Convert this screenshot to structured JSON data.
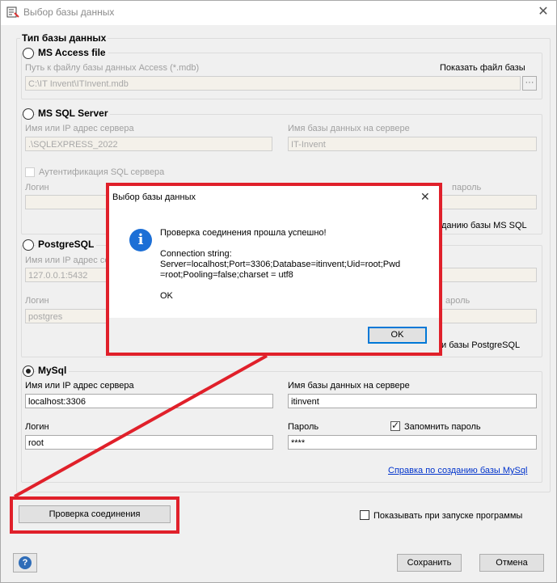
{
  "window": {
    "title": "Выбор базы данных",
    "close": "✕"
  },
  "db_type_group": {
    "title": "Тип базы данных"
  },
  "access": {
    "label": "MS Access file",
    "path_label": "Путь к файлу базы данных Access (*.mdb)",
    "show_file_label": "Показать файл базы",
    "path_value": "C:\\IT Invent\\ITInvent.mdb",
    "browse": "···"
  },
  "mssql": {
    "label": "MS SQL Server",
    "server_label": "Имя или IP адрес сервера",
    "server_value": ".\\SQLEXPRESS_2022",
    "db_label": "Имя базы данных на сервере",
    "db_value": "IT-Invent",
    "sql_auth_label": "Аутентификация SQL сервера",
    "login_label": "Логин",
    "password_label": "пароль",
    "help_link_partial": "данию базы MS SQL"
  },
  "postgres": {
    "label": "PostgreSQL",
    "server_label": "Имя или IP адрес серв",
    "server_value": "127.0.0.1:5432",
    "login_label": "Логин",
    "login_value": "postgres",
    "password_label": "ароль",
    "help_link_partial": "и базы PostgreSQL"
  },
  "mysql": {
    "label": "MySql",
    "selected": true,
    "server_label": "Имя или IP адрес сервера",
    "server_value": "localhost:3306",
    "db_label": "Имя базы данных на сервере",
    "db_value": "itinvent",
    "login_label": "Логин",
    "login_value": "root",
    "password_label": "Пароль",
    "password_value": "****",
    "remember_label": "Запомнить пароль",
    "remember_checked": true,
    "help_link": "Справка по созданию базы MySql"
  },
  "check_button": "Проверка соединения",
  "show_on_start_label": "Показывать при запуске программы",
  "help_button": "?",
  "save_button": "Сохранить",
  "cancel_button": "Отмена",
  "dialog": {
    "title": "Выбор базы данных",
    "close": "✕",
    "icon": "i",
    "message": "Проверка соединения прошла успешно!",
    "conn_label": "Connection string:",
    "conn_line1": "Server=localhost;Port=3306;Database=itinvent;Uid=root;Pwd",
    "conn_line2": "=root;Pooling=false;charset = utf8",
    "ok_text": "OK",
    "ok_button": "OK"
  },
  "colors": {
    "highlight": "#e0202a",
    "info_icon": "#1c6fd6",
    "link": "#0033cc"
  }
}
